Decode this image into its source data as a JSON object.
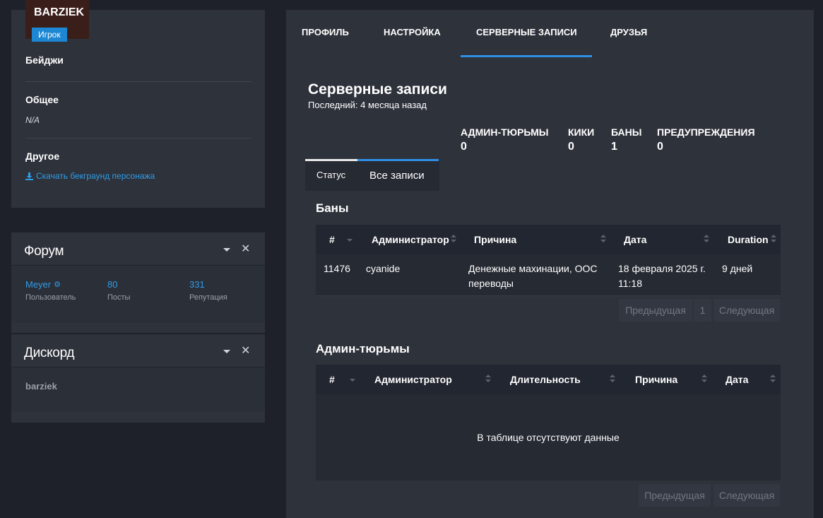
{
  "profile": {
    "username": "BARZIEK",
    "role": "Игрок",
    "sections": {
      "badges_title": "Бейджи",
      "general_title": "Общее",
      "general_value": "N/A",
      "other_title": "Другое",
      "download_link": "Скачать бекграунд персонажа"
    }
  },
  "forum_widget": {
    "title": "Форум",
    "user": {
      "value": "Meyer",
      "label": "Пользователь"
    },
    "posts": {
      "value": "80",
      "label": "Посты"
    },
    "reputation": {
      "value": "331",
      "label": "Репутация"
    }
  },
  "discord_widget": {
    "title": "Дискорд",
    "name": "barziek"
  },
  "tabs": [
    "ПРОФИЛЬ",
    "НАСТРОЙКА",
    "СЕРВЕРНЫЕ ЗАПИСИ",
    "ДРУЗЬЯ"
  ],
  "active_tab": "СЕРВЕРНЫЕ ЗАПИСИ",
  "records": {
    "title": "Серверные записи",
    "subtitle": "Последний: 4 месяца назад",
    "counts": [
      {
        "label": "АДМИН-ТЮРЬМЫ",
        "value": "0"
      },
      {
        "label": "КИКИ",
        "value": "0"
      },
      {
        "label": "БАНЫ",
        "value": "1"
      },
      {
        "label": "ПРЕДУПРЕЖДЕНИЯ",
        "value": "0"
      }
    ],
    "subtabs": [
      "Статус",
      "Все записи"
    ]
  },
  "bans": {
    "title": "Баны",
    "columns": [
      "#",
      "Администратор",
      "Причина",
      "Дата",
      "Duration"
    ],
    "rows": [
      {
        "id": "11476",
        "admin": "cyanide",
        "reason_l1": "Денежные махинации, OOC",
        "reason_l2": "переводы",
        "date_l1": "18 февраля 2025 г.",
        "date_l2": "11:18",
        "duration": "9 дней"
      }
    ],
    "pager": {
      "prev": "Предыдущая",
      "page": "1",
      "next": "Следующая"
    }
  },
  "jails": {
    "title": "Админ-тюрьмы",
    "columns": [
      "#",
      "Администратор",
      "Длительность",
      "Причина",
      "Дата"
    ],
    "empty": "В таблице отсутствуют данные",
    "pager": {
      "prev": "Предыдущая",
      "next": "Следующая"
    }
  },
  "colors": {
    "accent": "#2f8fe6",
    "link": "#2f9de6",
    "badge": "#1e87d4",
    "panel": "#2e323b",
    "background": "#1e2129"
  }
}
